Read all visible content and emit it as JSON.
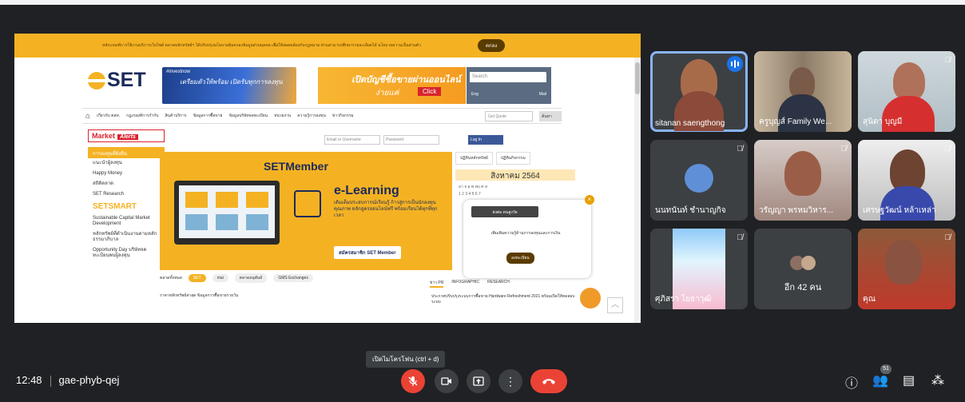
{
  "shared_screen": {
    "notice_text": "หลักเกณฑ์การใช้งานบริการเว็บไซต์ ตลาดหลักทรัพย์ฯ ได้ปรับปรุงนโยบายคุ้มครองข้อมูลส่วนบุคคล เพื่อให้สอดคล้องกับกฎหมาย ท่านสามารถศึกษารายละเอียดได้ นโยบายความเป็นส่วนตัว",
    "notice_button": "ตกลง",
    "logo": "SET",
    "banner1_tag": "#investnow",
    "banner1_text": "เตรียมตัวให้พร้อม เปิดรับทุกการลงทุน",
    "banner2_text": "เปิดบัญชีซื้อขายผ่านออนไลน์",
    "banner2_sub": "ง่ายแค่",
    "banner2_click": "Click",
    "search_placeholder": "Search",
    "search_left": "Eng",
    "search_right": "Mail",
    "nav_items": [
      "เกี่ยวกับ ตลท.",
      "กฎเกณฑ์การกำกับ",
      "สินค้าบริการ",
      "ข้อมูลการซื้อขาย",
      "ข้อมูลบริษัทจดทะเบียน",
      "หน่วยงาน",
      "ความรู้การลงทุน",
      "ข่าวกิจกรรม"
    ],
    "nav_search": "Get Quote",
    "nav_go": "ค้นหา",
    "market_label": "Market",
    "market_alerts": "Alerts",
    "sidebar_header": "การลงทุนที่ยั่งยืน",
    "sidebar_items": [
      "แนะนำผู้ลงทุน",
      "Happy Money",
      "สถิติตลาด",
      "SET Research"
    ],
    "setsmart": "SETSMART",
    "sidebar_items2": [
      "Sustainable Capital Market Development",
      "หลักทรัพย์ที่ดำเนินงานตามหลักธรรมาภิบาล",
      "Opportunity Day บริษัทจดทะเบียนพบผู้ลงทุน"
    ],
    "login_user": "Email or Username",
    "login_pass": "Password",
    "login_fb": "Log In",
    "member_title": "SETMember",
    "elearning_title": "e-Learning",
    "elearning_desc": "เติมเต็มประสบการณ์เรียนรู้ ก้าวสู่การเป็นนักลงทุนคุณภาพ หลักสูตรออนไลน์ฟรี พร้อมเรียนได้ทุกที่ทุกเวลา",
    "member_cta": "สมัครสมาชิก SET Member",
    "cal_tabs": [
      "ปฏิทินหลักทรัพย์",
      "ปฏิทินกิจกรรม"
    ],
    "cal_month": "สิงหาคม 2564",
    "popup_head": "ส่งต่อ คนสูงวัย",
    "popup_body": "เพิ่มเติมความรู้ด้านการลงทุนและการเงิน",
    "popup_btn": "ลงทะเบียน",
    "bottom_pills": [
      "ตลาดทั้งหมด",
      "SET",
      "mai",
      "ตลาดอนุพันธ์",
      "GMS Exchanges"
    ],
    "news_text": "ราคาหลักทรัพย์ล่าสุด ข้อมูลการซื้อขายรายวัน",
    "right_tabs": [
      "ข่าว PR",
      "INFOGRAPHIC",
      "RESEARCH"
    ],
    "right_news": "ประกาศปรับปรุงระบบการซื้อขาย Hardware Refreshment 2021 พร้อมเปิดให้ทดสอบระบบ"
  },
  "participants": [
    {
      "name": "sitanan saengthong",
      "speaking": true
    },
    {
      "name": "ครูบุญส์ Family We...",
      "muted": false
    },
    {
      "name": "สุนิตา บุญมี",
      "muted": true
    },
    {
      "name": "นนทนันท์ ชำนาญกิจ",
      "muted": true
    },
    {
      "name": "วรัญญา พรหมวิหาร...",
      "muted": true
    },
    {
      "name": "เศรษฐวัฒน์ หล้าเหล่า",
      "muted": true
    },
    {
      "name": "ศุภิสรา โยธาวุฒิ",
      "muted": true
    },
    {
      "name": "อีก 42 คน",
      "muted": false
    },
    {
      "name": "คุณ",
      "muted": true
    }
  ],
  "meeting": {
    "time": "12:48",
    "code": "gae-phyb-qej",
    "tooltip": "เปิดไมโครโฟน (ctrl + d)",
    "people_count": "51"
  },
  "colors": {
    "background": "#202124",
    "tile": "#3c4043",
    "accent_red": "#ea4335",
    "active_blue": "#8ab4f8",
    "set_orange": "#f4b223"
  }
}
